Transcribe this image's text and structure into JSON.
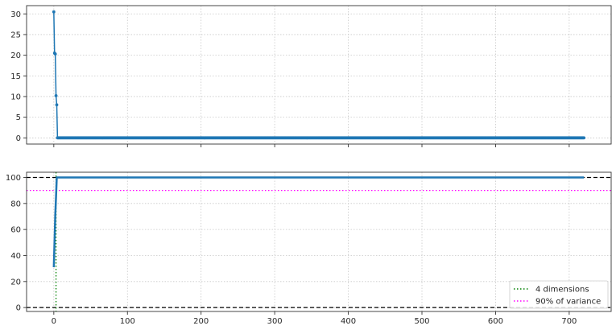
{
  "chart_data": [
    {
      "type": "line",
      "title": "",
      "xlabel": "",
      "ylabel": "",
      "xlim": [
        -37,
        757
      ],
      "ylim": [
        -1.5,
        32
      ],
      "xticks": [
        0,
        100,
        200,
        300,
        400,
        500,
        600,
        700
      ],
      "xtick_labels_visible": false,
      "yticks": [
        0,
        5,
        10,
        15,
        20,
        25,
        30
      ],
      "ytick_labels": [
        "0",
        "5",
        "10",
        "15",
        "20",
        "25",
        "30"
      ],
      "grid": true,
      "series": [
        {
          "color": "#1f77b4",
          "marker": "circle",
          "x_start": 0,
          "x_end": 720,
          "leading_values": [
            30.5,
            20.5,
            20.3,
            10.2,
            8.0
          ],
          "tail_value": 0.0
        }
      ]
    },
    {
      "type": "line",
      "title": "",
      "xlabel": "",
      "ylabel": "",
      "xlim": [
        -37,
        757
      ],
      "ylim": [
        -3,
        104
      ],
      "xticks": [
        0,
        100,
        200,
        300,
        400,
        500,
        600,
        700
      ],
      "xtick_labels": [
        "0",
        "100",
        "200",
        "300",
        "400",
        "500",
        "600",
        "700"
      ],
      "yticks": [
        0,
        20,
        40,
        60,
        80,
        100
      ],
      "ytick_labels": [
        "0",
        "20",
        "40",
        "60",
        "80",
        "100"
      ],
      "grid": true,
      "series": [
        {
          "color": "#1f77b4",
          "x_start": 0,
          "x_end": 720,
          "leading_values": [
            31,
            51,
            71,
            85,
            100
          ],
          "tail_value": 100
        }
      ],
      "reference_lines": [
        {
          "orientation": "horizontal",
          "value": 100,
          "color": "#000000",
          "style": "dashed"
        },
        {
          "orientation": "horizontal",
          "value": 0,
          "color": "#000000",
          "style": "dashed"
        },
        {
          "orientation": "horizontal",
          "value": 90,
          "color": "#ff00ff",
          "style": "dotted"
        },
        {
          "orientation": "vertical",
          "value": 3,
          "color": "#008000",
          "style": "dotted"
        }
      ],
      "legend": {
        "placement": "lower-right",
        "entries": [
          {
            "label": "4 dimensions",
            "color": "#008000",
            "style": "dotted"
          },
          {
            "label": "90% of variance",
            "color": "#ff00ff",
            "style": "dotted"
          }
        ]
      }
    }
  ]
}
